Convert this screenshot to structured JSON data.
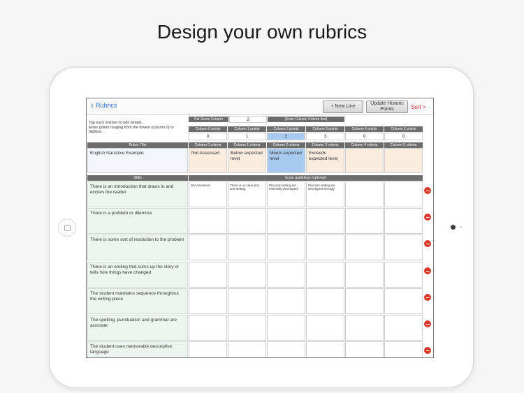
{
  "headline": "Design your own rubrics",
  "nav": {
    "back_label": "Rubrics",
    "new_line_label": "+ New Line",
    "update_label": "Update Historic Points",
    "sort_label": "Sort >"
  },
  "instructions": "Tap each textbox to edit details.\nEnter points ranging from the lowest (column 0) to highest.",
  "par_score": {
    "label": "Par Score Column",
    "value": "2",
    "criteria_hint": "(Enter Column Criteria first)"
  },
  "columns": [
    {
      "points_header": "Column 0 points",
      "points": "0",
      "criteria_header": "Column 0 criteria",
      "criteria": "Not Assessed",
      "guideline": "Not Assessed"
    },
    {
      "points_header": "Column 1 points",
      "points": "1",
      "criteria_header": "Column 1 criteria",
      "criteria": "Below expected level",
      "guideline": "There is no clear plot and setting."
    },
    {
      "points_header": "Column 2 points",
      "points": "2",
      "criteria_header": "Column 2 criteria",
      "criteria": "Meets expected level",
      "guideline": "Plot and setting are minimally developed."
    },
    {
      "points_header": "Column 3 points",
      "points": "3",
      "criteria_header": "Column 3 criteria",
      "criteria": "Exceeds expected level",
      "guideline": "Plot and setting are developed strongly."
    },
    {
      "points_header": "Column 4 points",
      "points": "0",
      "criteria_header": "Column 4 criteria",
      "criteria": "",
      "guideline": ""
    },
    {
      "points_header": "Column 5 points",
      "points": "0",
      "criteria_header": "Column 5 criteria",
      "criteria": "",
      "guideline": ""
    }
  ],
  "rubric_title": {
    "header": "Rubric Title",
    "value": "English Narrative Example"
  },
  "skills_header": "Skills",
  "guidelines_header": "Score guidelines (optional)",
  "skills": [
    "There is an introduction that draws in and excites the reader",
    "There is a problem or dilemma",
    "There is some sort of resolution to the problem",
    "There is an ending that sums up the story or tells how things have changed",
    "The student maintains sequence throughout the writing piece",
    "The spelling, punctuation and grammar are accurate",
    "The student uses memorable descriptive language"
  ],
  "colors": {
    "accent_blue": "#2a6fd6",
    "sort_red": "#d43030",
    "delete_red": "#d93a2b",
    "header_gray": "#6d6d6d",
    "highlight": "#a8c9f0"
  }
}
